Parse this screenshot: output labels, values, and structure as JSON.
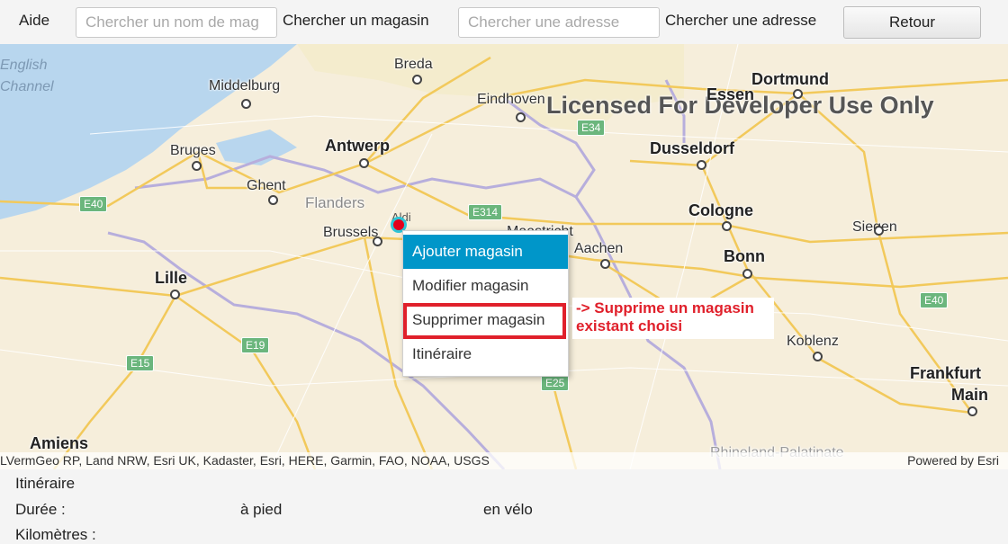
{
  "toolbar": {
    "help_label": "Aide",
    "store_search": {
      "placeholder": "Chercher un nom de mag",
      "label": "Chercher un magasin"
    },
    "address_search": {
      "placeholder": "Chercher une adresse",
      "label": "Chercher une adresse"
    },
    "back_label": "Retour"
  },
  "map": {
    "watermark": "Licensed For Developer Use Only",
    "poi_label": "Aldi",
    "cities": [
      {
        "name": "Breda"
      },
      {
        "name": "Dortmund"
      },
      {
        "name": "Middelburg"
      },
      {
        "name": "Eindhoven"
      },
      {
        "name": "Essen"
      },
      {
        "name": "Antwerp"
      },
      {
        "name": "Dusseldorf"
      },
      {
        "name": "Bruges"
      },
      {
        "name": "Ghent"
      },
      {
        "name": "Flanders"
      },
      {
        "name": "Brussels"
      },
      {
        "name": "Cologne"
      },
      {
        "name": "Maastricht"
      },
      {
        "name": "Aachen"
      },
      {
        "name": "Siegen"
      },
      {
        "name": "Bonn"
      },
      {
        "name": "Lille"
      },
      {
        "name": "Koblenz"
      },
      {
        "name": "Frankfurt"
      },
      {
        "name": "Main"
      },
      {
        "name": "Amiens"
      },
      {
        "name": "Rhineland-Palatinate"
      },
      {
        "name": "English"
      },
      {
        "name": "Channel"
      }
    ],
    "roads": [
      "E40",
      "E34",
      "E314",
      "E40",
      "E19",
      "E15",
      "E25"
    ],
    "attribution_left": "LVermGeo RP, Land NRW, Esri UK, Kadaster, Esri, HERE, Garmin, FAO, NOAA, USGS",
    "attribution_right": "Powered by Esri"
  },
  "context_menu": {
    "items": [
      {
        "label": "Ajouter magasin",
        "selected": true
      },
      {
        "label": "Modifier magasin",
        "selected": false
      },
      {
        "label": "Supprimer magasin",
        "selected": false
      },
      {
        "label": "Itinéraire",
        "selected": false
      }
    ]
  },
  "annotation": {
    "line1": "-> Supprime un magasin",
    "line2": "existant choisi",
    "color": "#e0202b"
  },
  "route_panel": {
    "title": "Itinéraire",
    "duration_label": "Durée :",
    "walk_label": "à pied",
    "bike_label": "en vélo",
    "km_label": "Kilomètres :"
  }
}
